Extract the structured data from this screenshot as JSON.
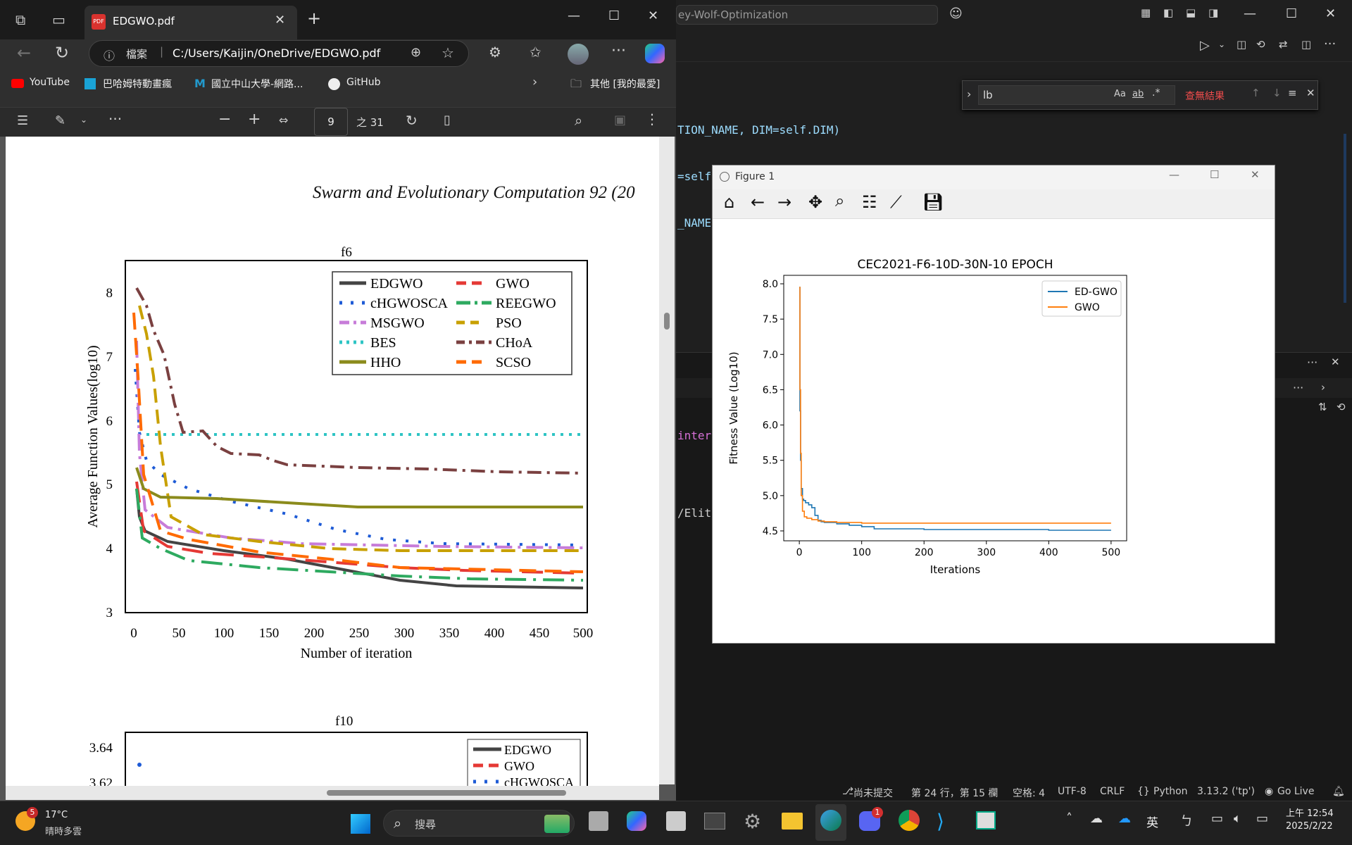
{
  "edge": {
    "tab_title": "EDGWO.pdf",
    "address_prefix": "檔案",
    "address": "C:/Users/Kaijin/OneDrive/EDGWO.pdf",
    "bookmarks": [
      "YouTube",
      "巴哈姆特動畫瘋",
      "國立中山大學-網路...",
      "GitHub"
    ],
    "other_favorites": "其他 [我的最愛]",
    "page_number": "9",
    "page_total": "之 31"
  },
  "pdf": {
    "header_text": "Swarm and Evolutionary Computation 92 (20",
    "chart1_title": "f6",
    "chart1_ylabel": "Average Function Values(log10)",
    "chart1_xlabel": "Number of iteration",
    "chart1_yticks": [
      "8",
      "7",
      "6",
      "5",
      "4",
      "3"
    ],
    "chart1_xticks": [
      "0",
      "50",
      "100",
      "150",
      "200",
      "250",
      "300",
      "350",
      "400",
      "450",
      "500"
    ],
    "legend": [
      "EDGWO",
      "GWO",
      "cHGWOSCA",
      "REEGWO",
      "MSGWO",
      "PSO",
      "BES",
      "CHoA",
      "HHO",
      "SCSO"
    ],
    "chart2_title": "f10",
    "chart2_yticks": [
      "3.64",
      "3.62"
    ],
    "chart2_legend": [
      "EDGWO",
      "GWO",
      "cHGWOSCA"
    ]
  },
  "vscode": {
    "title_fragment": "ey-Wolf-Optimization",
    "find_value": "lb",
    "find_result": "查無結果",
    "code_lines": [
      "TION_NAME, DIM=self.DIM)",
      "=self.NUM_WOLVES, YEAR=self.YEAR,",
      "_NAME, DIM=self.DIM)"
    ],
    "fragment1": "intern",
    "fragment2": "/Elite",
    "status": {
      "git": "尚未提交",
      "position": "第 24 行，第 15 欄",
      "spaces": "空格: 4",
      "encoding": "UTF-8",
      "eol": "CRLF",
      "lang": "Python",
      "version": "3.13.2 ('tp')",
      "golive": "Go Live"
    }
  },
  "figure": {
    "window_title": "Figure 1"
  },
  "chart_data": {
    "type": "line",
    "title": "CEC2021-F6-10D-30N-10 EPOCH",
    "xlabel": "Iterations",
    "ylabel": "Fitness Value (Log10)",
    "xlim": [
      -25,
      525
    ],
    "ylim": [
      4.36,
      8.12
    ],
    "xticks": [
      0,
      100,
      200,
      300,
      400,
      500
    ],
    "yticks": [
      4.5,
      5.0,
      5.5,
      6.0,
      6.5,
      7.0,
      7.5,
      8.0
    ],
    "legend_position": "top-right",
    "series": [
      {
        "name": "ED-GWO",
        "color": "#1f77b4",
        "x": [
          0,
          1,
          2,
          3,
          5,
          7,
          10,
          15,
          20,
          25,
          30,
          35,
          40,
          60,
          80,
          100,
          120,
          150,
          200,
          300,
          400,
          500
        ],
        "y": [
          7.95,
          6.2,
          5.5,
          5.1,
          4.95,
          4.93,
          4.9,
          4.87,
          4.83,
          4.72,
          4.65,
          4.63,
          4.62,
          4.6,
          4.58,
          4.56,
          4.53,
          4.53,
          4.52,
          4.52,
          4.51,
          4.51
        ]
      },
      {
        "name": "GWO",
        "color": "#ff7f0e",
        "x": [
          0,
          1,
          2,
          3,
          5,
          8,
          12,
          20,
          30,
          40,
          60,
          100,
          150,
          200,
          300,
          400,
          500
        ],
        "y": [
          7.95,
          6.5,
          5.6,
          5.0,
          4.78,
          4.7,
          4.68,
          4.66,
          4.64,
          4.63,
          4.62,
          4.61,
          4.61,
          4.61,
          4.61,
          4.61,
          4.61
        ]
      }
    ]
  },
  "taskbar": {
    "weather_temp": "17°C",
    "weather_desc": "晴時多雲",
    "weather_badge": "5",
    "search": "搜尋",
    "ime": "英",
    "time": "上午 12:54",
    "date": "2025/2/22"
  },
  "colors": {
    "accent": "#0078d4",
    "find_red": "#f14c4c"
  }
}
